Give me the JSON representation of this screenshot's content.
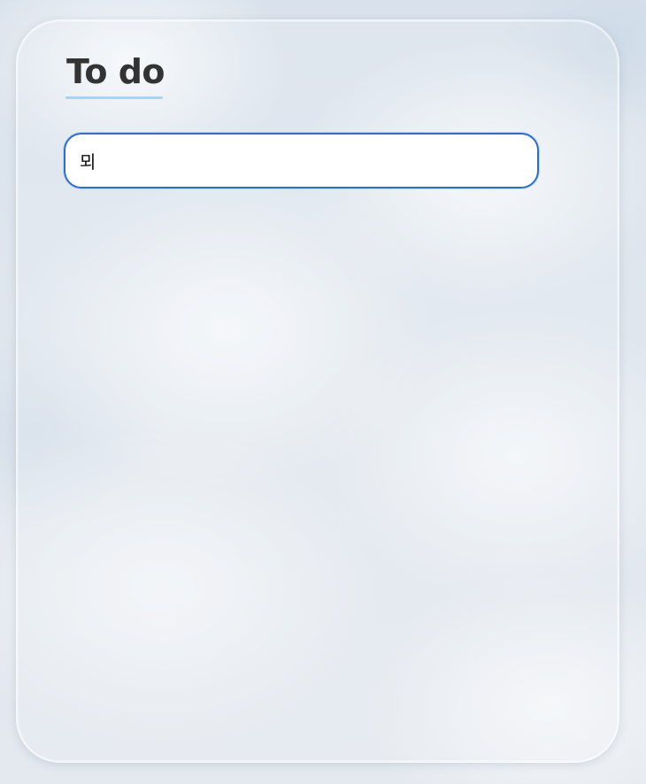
{
  "app": {
    "title": "To do"
  },
  "todo_input": {
    "value": "뫼",
    "placeholder": ""
  },
  "colors": {
    "title_text": "#333333",
    "title_underline": "#a6d4f5",
    "input_border": "#2f6fc7",
    "input_background": "#ffffff"
  }
}
